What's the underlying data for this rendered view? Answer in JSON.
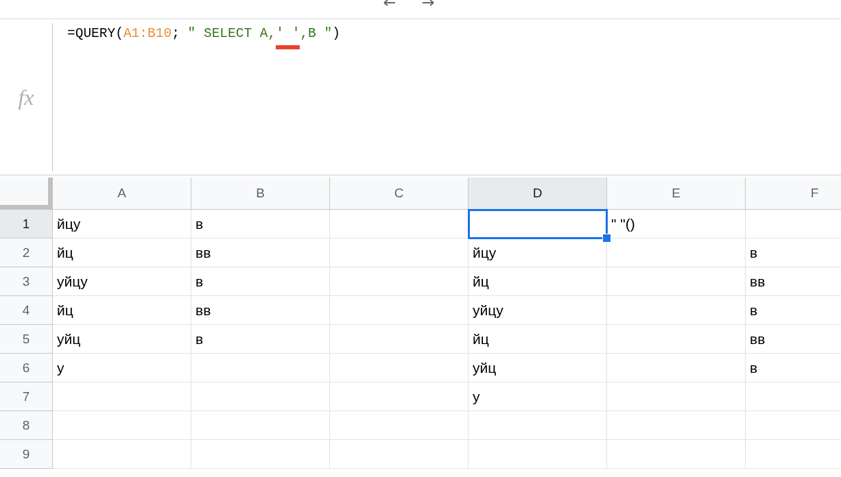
{
  "fx_label": "fx",
  "formula": [
    {
      "kind": "plain",
      "text": "=QUERY(",
      "underlined": false
    },
    {
      "kind": "range",
      "text": "A1:B10",
      "underlined": false
    },
    {
      "kind": "plain",
      "text": "; ",
      "underlined": false
    },
    {
      "kind": "string",
      "text": "\" SELECT A,",
      "underlined": false
    },
    {
      "kind": "string",
      "text": "' '",
      "underlined": true
    },
    {
      "kind": "string",
      "text": ",B \"",
      "underlined": false
    },
    {
      "kind": "plain",
      "text": ")",
      "underlined": false
    }
  ],
  "columns": [
    {
      "label": "A",
      "selected": false
    },
    {
      "label": "B",
      "selected": false
    },
    {
      "label": "C",
      "selected": false
    },
    {
      "label": "D",
      "selected": true
    },
    {
      "label": "E",
      "selected": false
    },
    {
      "label": "F",
      "selected": false
    }
  ],
  "rows": [
    {
      "number": "1",
      "selected": true,
      "cells": [
        {
          "text": "йцу",
          "selected": false
        },
        {
          "text": "в",
          "selected": false
        },
        {
          "selected": false
        },
        {
          "selected": true
        },
        {
          "text": "\" \"()",
          "selected": false
        },
        {
          "selected": false
        }
      ]
    },
    {
      "number": "2",
      "selected": false,
      "cells": [
        {
          "text": "йц",
          "selected": false
        },
        {
          "text": "вв",
          "selected": false
        },
        {
          "selected": false
        },
        {
          "text": "йцу",
          "selected": false
        },
        {
          "selected": false
        },
        {
          "text": "в",
          "selected": false
        }
      ]
    },
    {
      "number": "3",
      "selected": false,
      "cells": [
        {
          "text": "уйцу",
          "selected": false
        },
        {
          "text": "в",
          "selected": false
        },
        {
          "selected": false
        },
        {
          "text": "йц",
          "selected": false
        },
        {
          "selected": false
        },
        {
          "text": "вв",
          "selected": false
        }
      ]
    },
    {
      "number": "4",
      "selected": false,
      "cells": [
        {
          "text": "йц",
          "selected": false
        },
        {
          "text": "вв",
          "selected": false
        },
        {
          "selected": false
        },
        {
          "text": "уйцу",
          "selected": false
        },
        {
          "selected": false
        },
        {
          "text": "в",
          "selected": false
        }
      ]
    },
    {
      "number": "5",
      "selected": false,
      "cells": [
        {
          "text": "уйц",
          "selected": false
        },
        {
          "text": "в",
          "selected": false
        },
        {
          "selected": false
        },
        {
          "text": "йц",
          "selected": false
        },
        {
          "selected": false
        },
        {
          "text": "вв",
          "selected": false
        }
      ]
    },
    {
      "number": "6",
      "selected": false,
      "cells": [
        {
          "text": "у",
          "selected": false
        },
        {
          "selected": false
        },
        {
          "selected": false
        },
        {
          "text": "уйц",
          "selected": false
        },
        {
          "selected": false
        },
        {
          "text": "в",
          "selected": false
        }
      ]
    },
    {
      "number": "7",
      "selected": false,
      "cells": [
        {
          "selected": false
        },
        {
          "selected": false
        },
        {
          "selected": false
        },
        {
          "text": "у",
          "selected": false
        },
        {
          "selected": false
        },
        {
          "selected": false
        }
      ]
    },
    {
      "number": "8",
      "selected": false,
      "cells": [
        {
          "selected": false
        },
        {
          "selected": false
        },
        {
          "selected": false
        },
        {
          "selected": false
        },
        {
          "selected": false
        },
        {
          "selected": false
        }
      ]
    },
    {
      "number": "9",
      "selected": false,
      "cells": [
        {
          "selected": false
        },
        {
          "selected": false
        },
        {
          "selected": false
        },
        {
          "selected": false
        },
        {
          "selected": false
        },
        {
          "selected": false
        }
      ]
    }
  ]
}
